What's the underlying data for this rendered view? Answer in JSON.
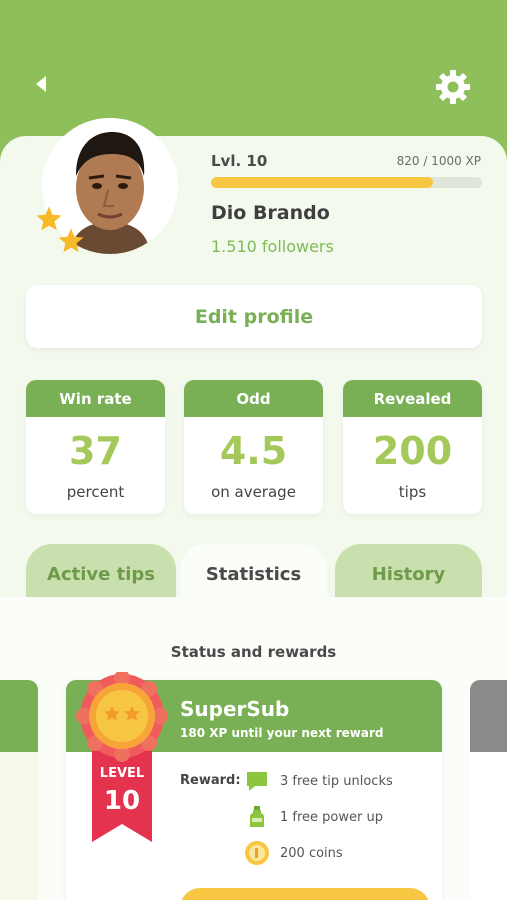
{
  "header": {
    "back_icon": "back-arrow-icon",
    "settings_icon": "gear-icon"
  },
  "profile": {
    "level": "Lvl. 10",
    "xp": "820 / 1000 XP",
    "xp_progress": 0.82,
    "name": "Dio Brando",
    "followers": "1.510 followers",
    "edit_label": "Edit profile"
  },
  "stats": [
    {
      "title": "Win rate",
      "value": "37",
      "sub": "percent"
    },
    {
      "title": "Odd",
      "value": "4.5",
      "sub": "on average"
    },
    {
      "title": "Revealed",
      "value": "200",
      "sub": "tips"
    }
  ],
  "tabs": [
    {
      "label": "Active tips",
      "active": false
    },
    {
      "label": "Statistics",
      "active": true
    },
    {
      "label": "History",
      "active": false
    }
  ],
  "rewards": {
    "section_title": "Status and rewards",
    "card": {
      "title": "SuperSub",
      "subtitle": "180 XP until your next reward",
      "badge_level_label": "LEVEL",
      "badge_level": "10",
      "reward_label": "Reward:",
      "items": [
        {
          "icon": "chat-bubble-icon",
          "text": "3 free tip unlocks"
        },
        {
          "icon": "potion-bottle-icon",
          "text": "1 free power up"
        },
        {
          "icon": "coin-icon",
          "text": "200 coins"
        }
      ]
    }
  },
  "colors": {
    "primary_green": "#7ab055",
    "light_green": "#c9dfae",
    "accent_yellow": "#f7c744",
    "badge_red": "#e3334f"
  }
}
